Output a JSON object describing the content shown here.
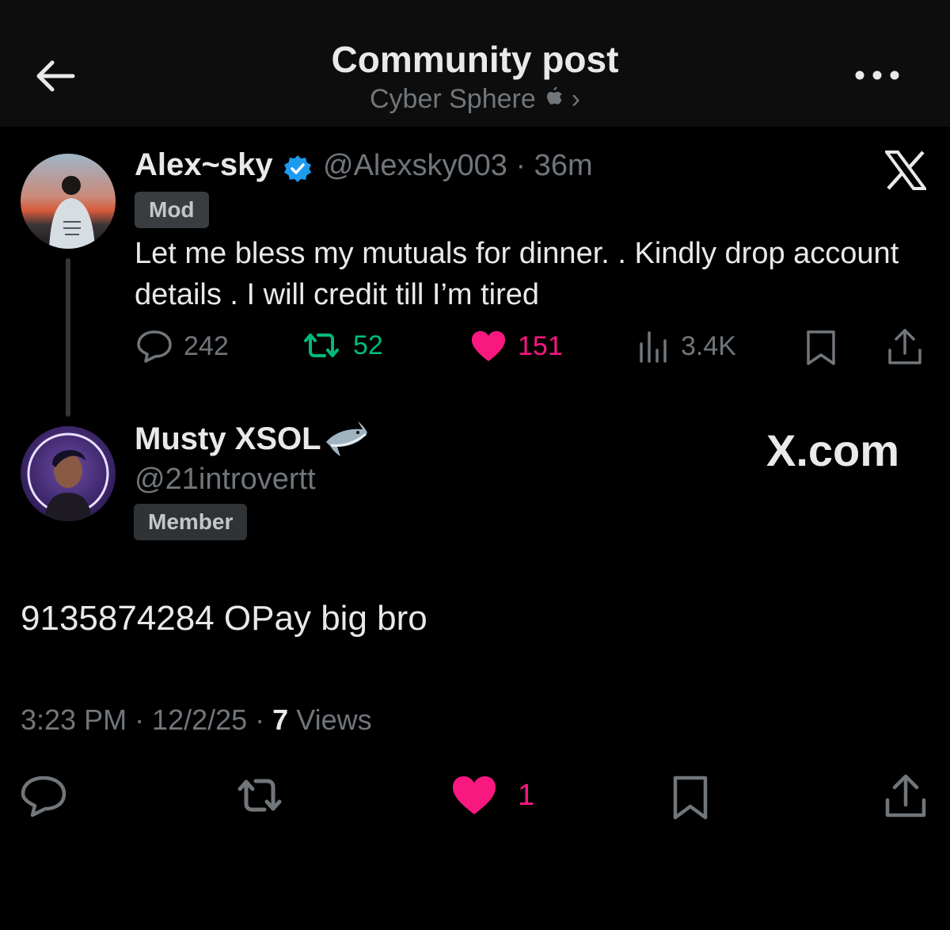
{
  "header": {
    "title": "Community post",
    "subtitle": "Cyber Sphere",
    "subtitle_icon": "apple-icon",
    "subtitle_chevron": "›"
  },
  "post": {
    "author_name": "Alex~sky",
    "author_handle": "@Alexsky003",
    "time": "· 36m",
    "badge": "Mod",
    "text": "Let me bless my mutuals for dinner. . Kindly drop account details . I will credit till I’m tired",
    "stats": {
      "replies": "242",
      "reposts": "52",
      "likes": "151",
      "views": "3.4K"
    }
  },
  "reply": {
    "author_name": "Musty XSOL",
    "author_handle": "@21introvertt",
    "badge": "Member",
    "watermark": "X.com",
    "text": "9135874284 OPay big bro",
    "meta_time": "3:23 PM · 12/2/25 · ",
    "meta_views_count": "7",
    "meta_views_label": " Views",
    "likes": "1"
  },
  "colors": {
    "background": "#000000",
    "header_background": "#0d0d0d",
    "text_primary": "#e7e9ea",
    "text_secondary": "#71767b",
    "repost_green": "#00ba7c",
    "like_pink": "#f91880",
    "verified_blue": "#1d9bf0"
  }
}
